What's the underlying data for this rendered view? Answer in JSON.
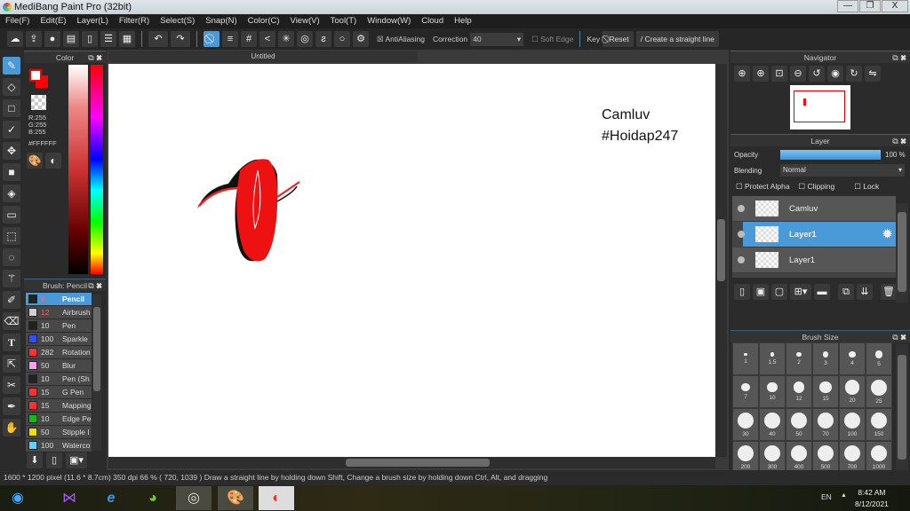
{
  "app": {
    "title": "MediBang Paint Pro (32bit)",
    "minimize": "—",
    "restore": "❐",
    "close": "X"
  },
  "menu": [
    "File(F)",
    "Edit(E)",
    "Layer(L)",
    "Filter(R)",
    "Select(S)",
    "Snap(N)",
    "Color(C)",
    "View(V)",
    "Tool(T)",
    "Window(W)",
    "Cloud",
    "Help"
  ],
  "toolbar": {
    "antialiasing": "AntiAliasing",
    "correction_label": "Correction",
    "correction_value": "40",
    "soft_edge": "Soft Edge",
    "key": "Key",
    "reset": "Reset",
    "straight_line": "Create a straight line"
  },
  "color_panel": {
    "title": "Color",
    "r": "R:255",
    "g": "G:255",
    "b": "B:255",
    "hex": "#FFFFFF",
    "primary": "#ff0000",
    "secondary": "#ffffff"
  },
  "brush_panel": {
    "title": "Brush: Pencil",
    "items": [
      {
        "size": "4",
        "name": "Pencil",
        "color": "#222222"
      },
      {
        "size": "12",
        "name": "Airbrush",
        "color": "#d0d0d0"
      },
      {
        "size": "10",
        "name": "Pen",
        "color": "#222222"
      },
      {
        "size": "100",
        "name": "Sparkle",
        "color": "#3050ff"
      },
      {
        "size": "282",
        "name": "Rotation",
        "color": "#ff3030"
      },
      {
        "size": "50",
        "name": "Blur",
        "color": "#ffa0f0"
      },
      {
        "size": "10",
        "name": "Pen (Sh",
        "color": "#222222"
      },
      {
        "size": "15",
        "name": "G Pen",
        "color": "#ff3030"
      },
      {
        "size": "15",
        "name": "Mapping",
        "color": "#ff3030"
      },
      {
        "size": "10",
        "name": "Edge Pe",
        "color": "#10c010"
      },
      {
        "size": "50",
        "name": "Stipple I",
        "color": "#f0e000"
      },
      {
        "size": "100",
        "name": "Waterco",
        "color": "#60d0ff"
      }
    ]
  },
  "canvas": {
    "tab": "Untitled",
    "text_line1": "Camluv",
    "text_line2": "#Hoidap247"
  },
  "navigator": {
    "title": "Navigator"
  },
  "layer_panel": {
    "title": "Layer",
    "opacity_label": "Opacity",
    "opacity_value": "100 %",
    "opacity": 1.0,
    "blending_label": "Blending",
    "blending_value": "Normal",
    "protect_alpha": "Protect Alpha",
    "clipping": "Clipping",
    "lock": "Lock",
    "layers": [
      {
        "name": "Camluv",
        "selected": false
      },
      {
        "name": "Layer1",
        "selected": true
      },
      {
        "name": "Layer1",
        "selected": false
      }
    ]
  },
  "brush_size": {
    "title": "Brush Size",
    "sizes": [
      "1",
      "1.5",
      "2",
      "3",
      "4",
      "5",
      "7",
      "10",
      "12",
      "15",
      "20",
      "25",
      "30",
      "40",
      "50",
      "70",
      "100",
      "150",
      "200",
      "300",
      "400",
      "500",
      "700",
      "1000"
    ]
  },
  "status": "1600 * 1200 pixel  (11.6 * 8.7cm)  350 dpi  66 %  ( 720, 1039 )  Draw a straight line by holding down Shift, Change a brush size by holding down Ctrl, Alt, and dragging",
  "taskbar": {
    "lang": "EN",
    "time": "8:42 AM",
    "date": "8/12/2021"
  }
}
